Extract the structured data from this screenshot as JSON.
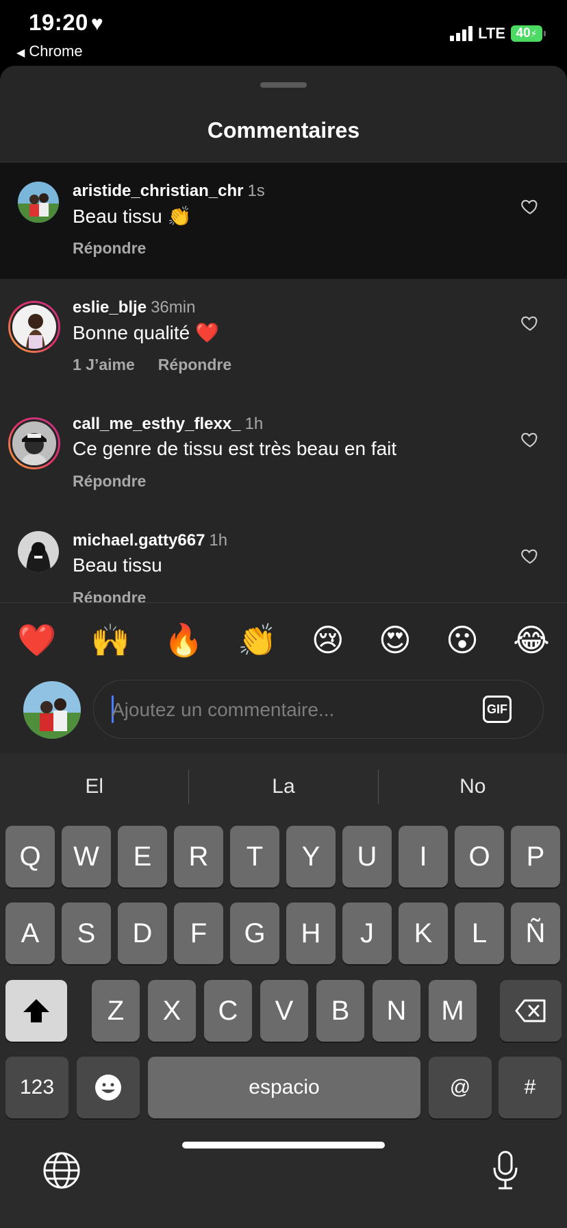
{
  "status_bar": {
    "time": "19:20",
    "back_app": "Chrome",
    "network": "LTE",
    "battery": "40"
  },
  "sheet": {
    "title": "Commentaires"
  },
  "comments": [
    {
      "username": "aristide_christian_chr",
      "time": "1s",
      "text": "Beau tissu 👏",
      "likes": "",
      "reply": "Répondre"
    },
    {
      "username": "eslie_blje",
      "time": "36min",
      "text": "Bonne qualité ❤️",
      "likes": "1 J’aime",
      "reply": "Répondre"
    },
    {
      "username": "call_me_esthy_flexx_",
      "time": "1h",
      "text": "Ce genre de tissu est très beau en fait",
      "likes": "",
      "reply": "Répondre"
    },
    {
      "username": "michael.gatty667",
      "time": "1h",
      "text": "Beau tissu",
      "likes": "",
      "reply": "Répondre"
    }
  ],
  "emoji_reactions": [
    "❤️",
    "🙌",
    "🔥",
    "👏",
    "😢",
    "😍",
    "😮",
    "😂"
  ],
  "compose": {
    "placeholder": "Ajoutez un commentaire...",
    "gif_label": "GIF"
  },
  "keyboard": {
    "suggestions": [
      "El",
      "La",
      "No"
    ],
    "row1": [
      "Q",
      "W",
      "E",
      "R",
      "T",
      "Y",
      "U",
      "I",
      "O",
      "P"
    ],
    "row2": [
      "A",
      "S",
      "D",
      "F",
      "G",
      "H",
      "J",
      "K",
      "L",
      "Ñ"
    ],
    "row3": [
      "Z",
      "X",
      "C",
      "V",
      "B",
      "N",
      "M"
    ],
    "numbers_label": "123",
    "space_label": "espacio",
    "at_label": "@",
    "hash_label": "#"
  },
  "colors": {
    "sheet_bg": "#262626",
    "highlight_bg": "#121212",
    "secondary_text": "#a8a8a8",
    "caret": "#4a7dff",
    "battery": "#4cd964"
  }
}
